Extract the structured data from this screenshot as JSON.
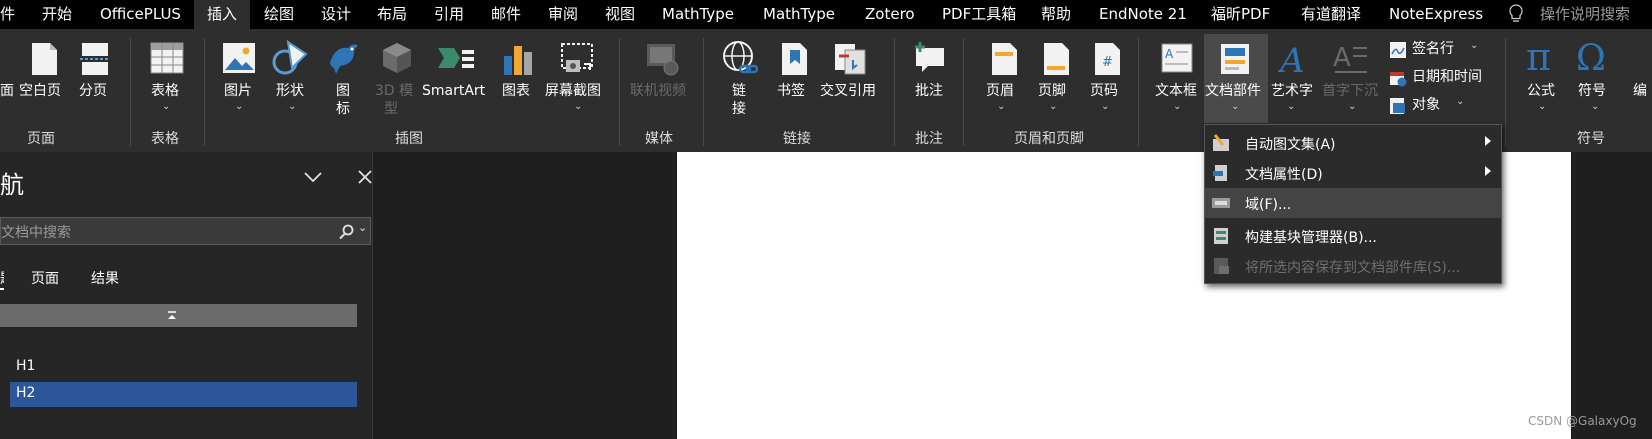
{
  "menubar": {
    "tabs": [
      "件",
      "开始",
      "OfficePLUS",
      "插入",
      "绘图",
      "设计",
      "布局",
      "引用",
      "邮件",
      "审阅",
      "视图",
      "MathType",
      "MathType",
      "Zotero",
      "PDF工具箱",
      "帮助",
      "EndNote 21",
      "福昕PDF",
      "有道翻译",
      "NoteExpress"
    ],
    "search_label": "操作说明搜索"
  },
  "ribbon": {
    "pages": {
      "blank_prefix": "面",
      "blank_page": "空白页",
      "page_break": "分页",
      "group": "页面"
    },
    "tables": {
      "table": "表格",
      "group": "表格"
    },
    "illustrations": {
      "pictures": "图片",
      "shapes": "形状",
      "icons_1": "图",
      "icons_2": "标",
      "model3d_1": "3D 模",
      "model3d_2": "型",
      "smartart": "SmartArt",
      "chart": "图表",
      "screenshot": "屏幕截图",
      "group": "插图"
    },
    "media": {
      "online_video": "联机视频",
      "group": "媒体"
    },
    "links": {
      "link_1": "链",
      "link_2": "接",
      "bookmark": "书签",
      "cross_ref": "交叉引用",
      "group": "链接"
    },
    "comments": {
      "comment": "批注",
      "group": "批注"
    },
    "header_footer": {
      "header": "页眉",
      "footer": "页脚",
      "page_number": "页码",
      "group": "页眉和页脚"
    },
    "text": {
      "textbox": "文本框",
      "quick_parts": "文档部件",
      "wordart": "艺术字",
      "dropcap": "首字下沉",
      "signature": "签名行",
      "datetime": "日期和时间",
      "object": "对象"
    },
    "symbols": {
      "equation": "公式",
      "symbol": "符号",
      "numbering_partial": "编",
      "group": "符号"
    }
  },
  "dropdown": {
    "items": [
      {
        "label": "自动图文集(A)",
        "has_submenu": true
      },
      {
        "label": "文档属性(D)",
        "has_submenu": true
      },
      {
        "label": "域(F)...",
        "has_submenu": false
      },
      {
        "label": "构建基块管理器(B)...",
        "has_submenu": false
      },
      {
        "label": "将所选内容保存到文档部件库(S)...",
        "has_submenu": false
      }
    ]
  },
  "navpane": {
    "title": "航",
    "search_placeholder": "文档中搜索",
    "tabs": [
      "题",
      "页面",
      "结果"
    ],
    "headings": [
      "H1",
      "H2"
    ]
  },
  "watermark": "CSDN @GalaxyOg",
  "colors": {
    "selected_heading": "#2b579a",
    "menubar_bg": "#000000",
    "ribbon_bg": "#2e2e2e"
  }
}
